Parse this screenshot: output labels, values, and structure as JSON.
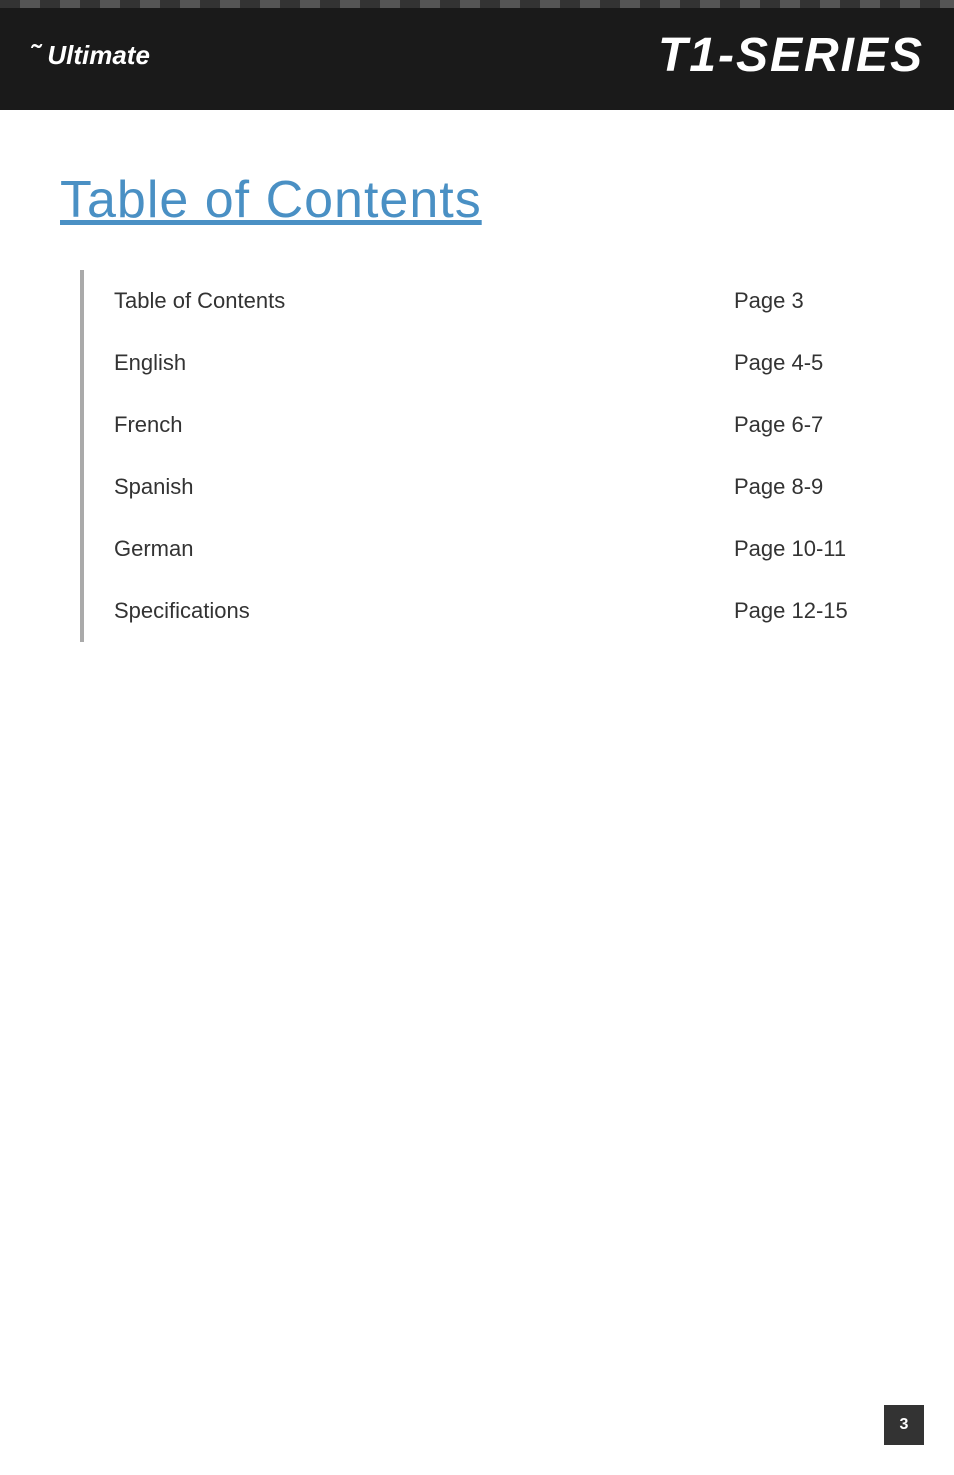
{
  "header": {
    "logo_icon": "⟲",
    "logo_text": "Ultimate",
    "product_title": "T1-SERIES"
  },
  "main": {
    "toc_heading": "Table of Contents",
    "toc_items": [
      {
        "name": "Table of Contents",
        "page": "Page 3"
      },
      {
        "name": "English",
        "page": "Page 4-5"
      },
      {
        "name": "French",
        "page": "Page 6-7"
      },
      {
        "name": "Spanish",
        "page": "Page 8-9"
      },
      {
        "name": "German",
        "page": "Page 10-11"
      },
      {
        "name": "Specifications",
        "page": "Page 12-15"
      }
    ]
  },
  "footer": {
    "page_number": "3"
  }
}
